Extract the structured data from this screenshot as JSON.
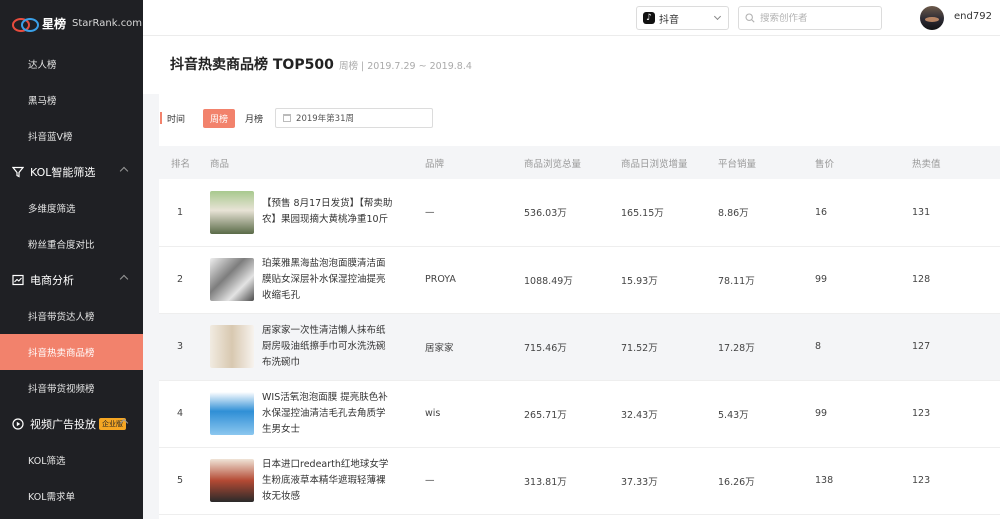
{
  "brand": {
    "name": "星榜",
    "site": "StarRank.com"
  },
  "sidebar": {
    "items": [
      {
        "label": "达人榜"
      },
      {
        "label": "黑马榜"
      },
      {
        "label": "抖音蓝V榜"
      }
    ],
    "groups": [
      {
        "label": "KOL智能筛选",
        "items": [
          {
            "label": "多维度筛选"
          },
          {
            "label": "粉丝重合度对比"
          }
        ]
      },
      {
        "label": "电商分析",
        "items": [
          {
            "label": "抖音带货达人榜"
          },
          {
            "label": "抖音热卖商品榜"
          },
          {
            "label": "抖音带货视频榜"
          }
        ]
      },
      {
        "label": "视频广告投放",
        "badge": "企业版",
        "items": [
          {
            "label": "KOL筛选"
          },
          {
            "label": "KOL需求单"
          }
        ]
      }
    ]
  },
  "topbar": {
    "platform": "抖音",
    "search_placeholder": "搜索创作者",
    "username": "end792"
  },
  "page": {
    "title": "抖音热卖商品榜 TOP500",
    "period": "周榜 | 2019.7.29 ~ 2019.8.4"
  },
  "filter": {
    "label": "时间",
    "tab_week": "周榜",
    "tab_month": "月榜",
    "date": "2019年第31周"
  },
  "table": {
    "headers": [
      "排名",
      "商品",
      "品牌",
      "商品浏览总量",
      "商品日浏览增量",
      "平台销量",
      "售价",
      "热卖值"
    ],
    "rows": [
      {
        "rank": "1",
        "name": "【预售 8月17日发货】【帮卖助农】果园现摘大黄桃净重10斤",
        "brand": "—",
        "views": "536.03万",
        "daily": "165.15万",
        "sales": "8.86万",
        "price": "16",
        "hot": "131"
      },
      {
        "rank": "2",
        "name": "珀莱雅黑海盐泡泡面膜清洁面膜贴女深层补水保湿控油提亮收缩毛孔",
        "brand": "PROYA",
        "views": "1088.49万",
        "daily": "15.93万",
        "sales": "78.11万",
        "price": "99",
        "hot": "128"
      },
      {
        "rank": "3",
        "name": "居家家一次性清洁懒人抹布纸厨房吸油纸擦手巾可水洗洗碗布洗碗巾",
        "brand": "居家家",
        "views": "715.46万",
        "daily": "71.52万",
        "sales": "17.28万",
        "price": "8",
        "hot": "127"
      },
      {
        "rank": "4",
        "name": "WIS活氧泡泡面膜 提亮肤色补水保湿控油清洁毛孔去角质学生男女士",
        "brand": "wis",
        "views": "265.71万",
        "daily": "32.43万",
        "sales": "5.43万",
        "price": "99",
        "hot": "123"
      },
      {
        "rank": "5",
        "name": "日本进口redearth红地球女学生粉底液草本精华遮瑕轻薄裸妆无妆感",
        "brand": "—",
        "views": "313.81万",
        "daily": "37.33万",
        "sales": "16.26万",
        "price": "138",
        "hot": "123"
      }
    ]
  },
  "colors": {
    "accent": "#f2826c",
    "sidebar_bg": "#1f2024"
  }
}
